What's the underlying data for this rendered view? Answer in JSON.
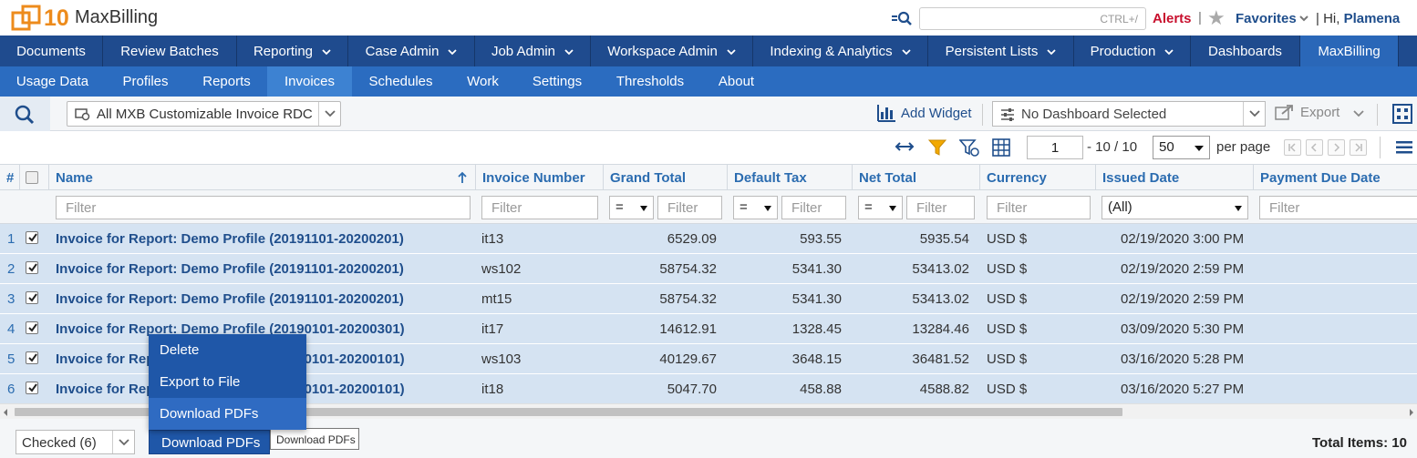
{
  "topbar": {
    "logo_number": "10",
    "app_name": "MaxBilling",
    "search_placeholder": "CTRL+/",
    "alerts": "Alerts",
    "separator": "|",
    "favorites": "Favorites",
    "greeting": "| Hi,",
    "user": "Plamena"
  },
  "main_nav": [
    {
      "label": "Documents",
      "dropdown": false
    },
    {
      "label": "Review Batches",
      "dropdown": false
    },
    {
      "label": "Reporting",
      "dropdown": true
    },
    {
      "label": "Case Admin",
      "dropdown": true
    },
    {
      "label": "Job Admin",
      "dropdown": true
    },
    {
      "label": "Workspace Admin",
      "dropdown": true
    },
    {
      "label": "Indexing & Analytics",
      "dropdown": true
    },
    {
      "label": "Persistent Lists",
      "dropdown": true
    },
    {
      "label": "Production",
      "dropdown": true
    },
    {
      "label": "Dashboards",
      "dropdown": false
    },
    {
      "label": "MaxBilling",
      "dropdown": false,
      "active": true
    }
  ],
  "sub_nav": [
    {
      "label": "Usage Data"
    },
    {
      "label": "Profiles"
    },
    {
      "label": "Reports"
    },
    {
      "label": "Invoices",
      "active": true
    },
    {
      "label": "Schedules"
    },
    {
      "label": "Work"
    },
    {
      "label": "Settings"
    },
    {
      "label": "Thresholds"
    },
    {
      "label": "About"
    }
  ],
  "toolbar": {
    "view_select": "All MXB Customizable Invoice RDC",
    "add_widget": "Add Widget",
    "dashboard_select": "No Dashboard Selected",
    "export": "Export"
  },
  "pager": {
    "current_page": "1",
    "range_text": "- 10 / 10",
    "per_page_value": "50",
    "per_page_label": "per page"
  },
  "grid": {
    "columns": {
      "num": "#",
      "name": "Name",
      "invoice_number": "Invoice Number",
      "grand_total": "Grand Total",
      "default_tax": "Default Tax",
      "net_total": "Net Total",
      "currency": "Currency",
      "issued_date": "Issued Date",
      "payment_due_date": "Payment Due Date"
    },
    "filter_placeholder": "Filter",
    "filter_operator": "=",
    "filter_all": "(All)",
    "rows": [
      {
        "num": "1",
        "name": "Invoice for Report: Demo Profile (20191101-20200201)",
        "invoice_number": "it13",
        "grand_total": "6529.09",
        "default_tax": "593.55",
        "net_total": "5935.54",
        "currency": "USD $",
        "issued_date": "02/19/2020 3:00 PM",
        "checked": true
      },
      {
        "num": "2",
        "name": "Invoice for Report: Demo Profile (20191101-20200201)",
        "invoice_number": "ws102",
        "grand_total": "58754.32",
        "default_tax": "5341.30",
        "net_total": "53413.02",
        "currency": "USD $",
        "issued_date": "02/19/2020 2:59 PM",
        "checked": true
      },
      {
        "num": "3",
        "name": "Invoice for Report: Demo Profile (20191101-20200201)",
        "invoice_number": "mt15",
        "grand_total": "58754.32",
        "default_tax": "5341.30",
        "net_total": "53413.02",
        "currency": "USD $",
        "issued_date": "02/19/2020 2:59 PM",
        "checked": true
      },
      {
        "num": "4",
        "name": "Invoice for Report: Demo Profile (20190101-20200301)",
        "invoice_number": "it17",
        "grand_total": "14612.91",
        "default_tax": "1328.45",
        "net_total": "13284.46",
        "currency": "USD $",
        "issued_date": "03/09/2020 5:30 PM",
        "checked": true
      },
      {
        "num": "5",
        "name": "Invoice for Report: Demo Profile (20200101-20200101)",
        "invoice_number": "ws103",
        "grand_total": "40129.67",
        "default_tax": "3648.15",
        "net_total": "36481.52",
        "currency": "USD $",
        "issued_date": "03/16/2020 5:28 PM",
        "checked": true
      },
      {
        "num": "6",
        "name": "Invoice for Report: Demo Profile (20200101-20200101)",
        "invoice_number": "it18",
        "grand_total": "5047.70",
        "default_tax": "458.88",
        "net_total": "4588.82",
        "currency": "USD $",
        "issued_date": "03/16/2020 5:27 PM",
        "checked": true
      }
    ]
  },
  "footer": {
    "checked_select": "Checked (6)",
    "action_button": "Download PDFs",
    "tooltip": "Download PDFs",
    "total_items": "Total Items: 10"
  },
  "popup_menu": [
    {
      "label": "Delete"
    },
    {
      "label": "Export to File"
    },
    {
      "label": "Download PDFs",
      "hover": true
    }
  ],
  "colors": {
    "main_nav_bg": "#1f4b8e",
    "sub_nav_bg": "#2b6cc0",
    "row_selected": "#d5e3f2",
    "alert_red": "#c8102e",
    "brand_orange": "#ed8b1c"
  }
}
